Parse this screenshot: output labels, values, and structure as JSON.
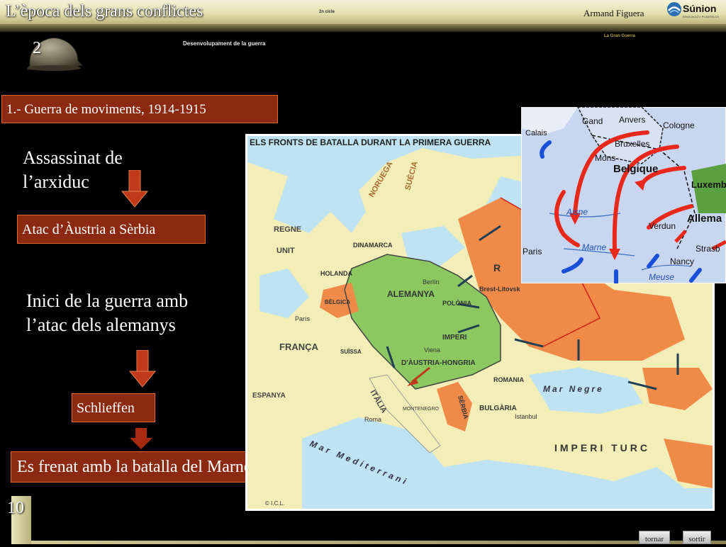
{
  "header": {
    "title": "L’època dels grans conflictes",
    "center_small": "2n cicle",
    "author": "Armand Figuera",
    "logo_text": "Súnion",
    "logo_sub": "EDUCACIÓ I PLANTELLS",
    "section_tag": "La Gran Guerra",
    "subtitle": "Desenvolupament de la guerra",
    "unit_number": "2"
  },
  "content": {
    "section_title": "1.- Guerra de moviments, 1914-1915",
    "step1_text": "Assassinat de l’arxiduc",
    "step1_effect": "Atac d’Àustria a Sèrbia",
    "step2_text": "Inici de la guerra amb l’atac dels alemanys",
    "step2_effect": "Schlieffen",
    "final_text": "Es frenat amb la batalla del Marne"
  },
  "main_map": {
    "title": "ELS FRONTS DE BATALLA DURANT LA PRIMERA GUERRA",
    "labels": {
      "noruega": "NORUEGA",
      "suecia": "SUÈCIA",
      "regne_unit_1": "REGNE",
      "regne_unit_2": "UNIT",
      "dinamarca": "DINAMARCA",
      "holanda": "HOLANDA",
      "alemanya": "ALEMANYA",
      "berlin": "Berlín",
      "belgica": "BÈLGICA",
      "paris": "París",
      "franca": "FRANÇA",
      "suissa": "SUÏSSA",
      "espanya": "ESPANYA",
      "italia": "ITÀLIA",
      "roma": "Roma",
      "viena": "Viena",
      "imperi_austria": "IMPERI",
      "austria_hongria": "D'ÀUSTRIA-HONGRIA",
      "montenegro": "MONTENEGRO",
      "serbia": "SÈRBIA",
      "romania": "ROMANIA",
      "bulgaria": "BULGÀRIA",
      "istanbul": "Istanbul",
      "polonia": "POLÒNIA",
      "brest": "Brest-Litovsk",
      "russia": "R",
      "mar_negre": "Mar Negre",
      "imperi_turc": "IMPERI TURC",
      "mediterrani": "Mar Mediterrani",
      "credit": "© I.C.L."
    }
  },
  "inset_map": {
    "labels": {
      "calais": "Calais",
      "gand": "Gand",
      "anvers": "Anvers",
      "cologne": "Cologne",
      "bruxelles": "Bruxelles",
      "mons": "Mons",
      "belgique": "Belgique",
      "luxemb": "Luxemb",
      "aisne": "Aisne",
      "verdun": "Verdun",
      "allema": "Allema",
      "paris": "Paris",
      "marne": "Marne",
      "nancy": "Nancy",
      "strasb": "Strasb",
      "meuse": "Meuse"
    }
  },
  "footer": {
    "slide_number": "10",
    "back_label": "tornar",
    "exit_label": "sortir"
  },
  "colors": {
    "box_bg": "#8b2a10",
    "box_border": "#e06a30",
    "arrow": "#c0391b",
    "central_powers": "#8cc860",
    "russia_front": "#f08a48"
  },
  "icons": [
    "helmet-icon",
    "down-arrow-icon",
    "sunion-logo-icon"
  ]
}
